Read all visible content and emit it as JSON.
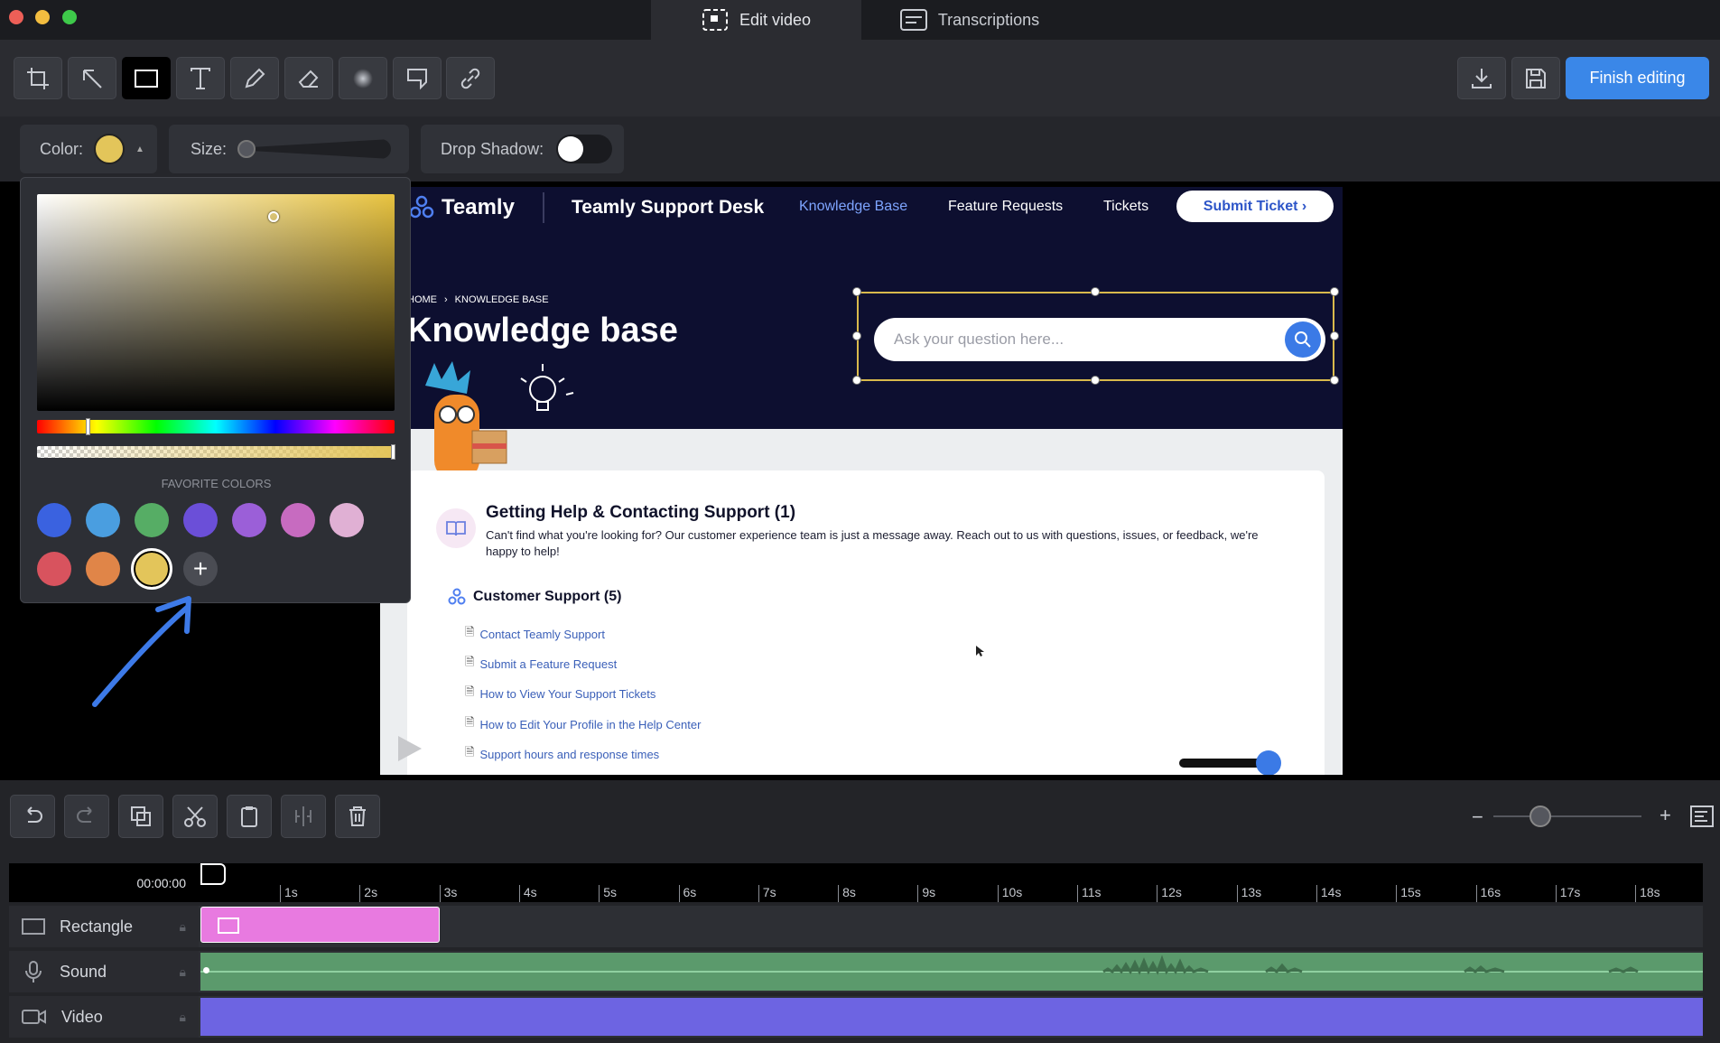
{
  "tabs": [
    {
      "label": "Edit video",
      "active": true
    },
    {
      "label": "Transcriptions",
      "active": false
    }
  ],
  "toolbar": {
    "finish_label": "Finish editing"
  },
  "props": {
    "color_label": "Color:",
    "size_label": "Size:",
    "shadow_label": "Drop Shadow:",
    "selected_color": "#e3c55a"
  },
  "picker": {
    "favorites_label": "FAVORITE COLORS",
    "swatches": [
      "#3a62e0",
      "#4a9ee0",
      "#56ad65",
      "#6b4fd8",
      "#9b5fd8",
      "#c76bc0",
      "#e0b0d4",
      "#d8535e",
      "#e08548",
      "#e3c55a"
    ]
  },
  "video": {
    "brand": "Teamly",
    "desk": "Teamly Support Desk",
    "nav": [
      "Knowledge Base",
      "Feature Requests",
      "Tickets"
    ],
    "submit": "Submit Ticket ›",
    "breadcrumb_home": "HOME",
    "breadcrumb_current": "KNOWLEDGE BASE",
    "title": "Knowledge base",
    "search_placeholder": "Ask your question here...",
    "section1_title": "Getting Help & Contacting Support (1)",
    "section1_desc": "Can't find what you're looking for? Our customer experience team is just a message away. Reach out to us with questions, issues, or feedback, we're happy to help!",
    "section2_title": "Customer Support (5)",
    "links": [
      "Contact Teamly Support",
      "Submit a Feature Request",
      "How to View Your Support Tickets",
      "How to Edit Your Profile in the Help Center",
      "Support hours and response times"
    ]
  },
  "timeline": {
    "time": "00:00:00",
    "ticks": [
      "1s",
      "2s",
      "3s",
      "4s",
      "5s",
      "6s",
      "7s",
      "8s",
      "9s",
      "10s",
      "11s",
      "12s",
      "13s",
      "14s",
      "15s",
      "16s",
      "17s",
      "18s"
    ],
    "tracks": [
      {
        "label": "Rectangle"
      },
      {
        "label": "Sound"
      },
      {
        "label": "Video"
      }
    ],
    "clip_colors": {
      "rectangle": "#e87ae0",
      "sound": "#5b9a6c",
      "video": "#6d64e2"
    }
  }
}
